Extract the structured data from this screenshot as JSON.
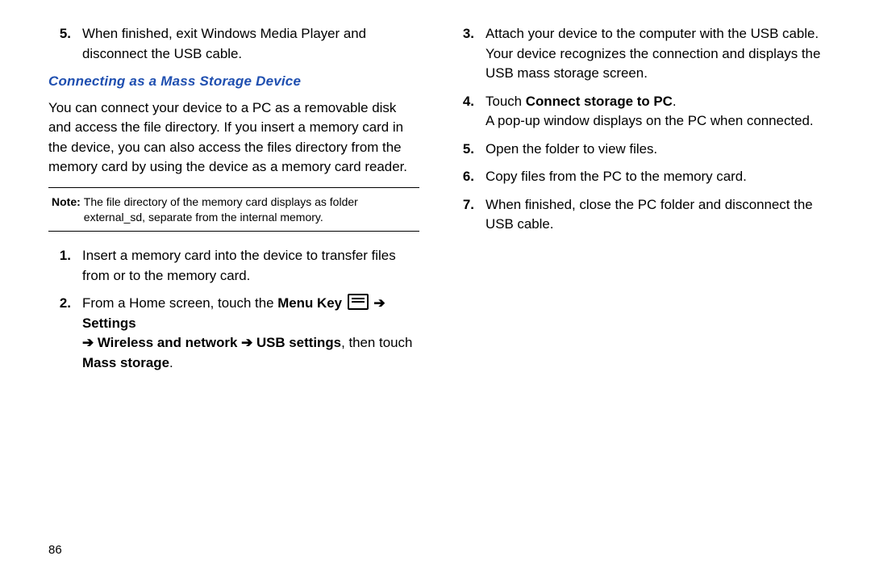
{
  "left": {
    "step5": {
      "num": "5.",
      "text": "When finished, exit Windows Media Player and disconnect the USB cable."
    },
    "heading": "Connecting as a Mass Storage Device",
    "intro": "You can connect your device to a PC as a removable disk and access the file directory. If you insert a memory card in the device, you can also access the files directory from the memory card by using the device as a memory card reader.",
    "note": {
      "label": "Note:",
      "text": "The file directory of the memory card displays as folder external_sd, separate from the internal memory."
    },
    "step1": {
      "num": "1.",
      "text": "Insert a memory card into the device to transfer files from or to the memory card."
    },
    "step2": {
      "num": "2.",
      "prefix": "From a Home screen, touch the ",
      "menu_key": "Menu Key",
      "arrow": "➔",
      "settings": "Settings",
      "wireless": "Wireless and network",
      "usb": "USB settings",
      "then_touch": ", then touch",
      "mass_storage": "Mass storage",
      "period": "."
    }
  },
  "right": {
    "step3": {
      "num": "3.",
      "text": "Attach your device to the computer with the USB cable. Your device recognizes the connection and displays the USB mass storage screen."
    },
    "step4": {
      "num": "4.",
      "touch": "Touch ",
      "bold": "Connect storage to PC",
      "period": ".",
      "line2": "A pop-up window displays on the PC when connected."
    },
    "step5": {
      "num": "5.",
      "text": "Open the folder to view files."
    },
    "step6": {
      "num": "6.",
      "text": "Copy files from the PC to the memory card."
    },
    "step7": {
      "num": "7.",
      "text": "When finished, close the PC folder and disconnect the USB cable."
    }
  },
  "page_number": "86"
}
